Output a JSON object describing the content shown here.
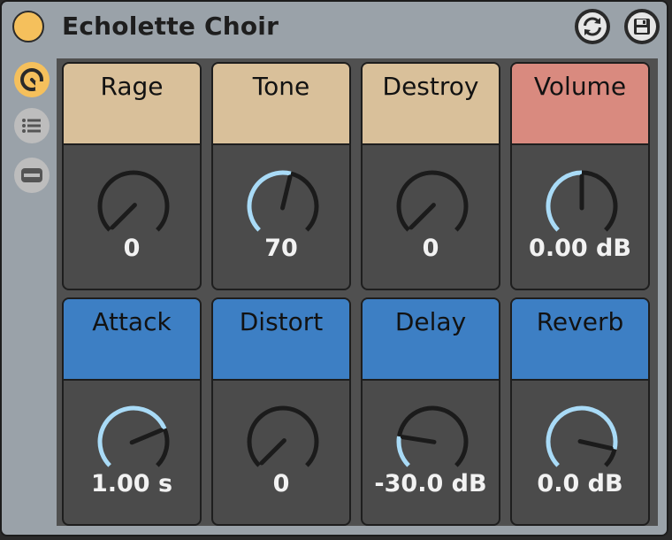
{
  "device": {
    "title": "Echolette Choir",
    "power_color": "#f5c05c",
    "icons": {
      "power": "power-toggle-icon",
      "hot_swap": "hot-swap-icon",
      "save": "save-preset-icon"
    }
  },
  "sidebar": {
    "items": [
      {
        "icon": "macro-knobs-icon",
        "active": true
      },
      {
        "icon": "list-icon",
        "active": false
      },
      {
        "icon": "collapse-icon",
        "active": false
      }
    ]
  },
  "macros": [
    {
      "label": "Rage",
      "value": "0",
      "level": 0.0,
      "header_color": "#d9c09a"
    },
    {
      "label": "Tone",
      "value": "70",
      "level": 0.55,
      "header_color": "#d9c09a"
    },
    {
      "label": "Destroy",
      "value": "0",
      "level": 0.0,
      "header_color": "#d9c09a"
    },
    {
      "label": "Volume",
      "value": "0.00 dB",
      "level": 0.5,
      "header_color": "#d98a7f"
    },
    {
      "label": "Attack",
      "value": "1.00 s",
      "level": 0.75,
      "header_color": "#3d7fc4"
    },
    {
      "label": "Distort",
      "value": "0",
      "level": 0.0,
      "header_color": "#3d7fc4"
    },
    {
      "label": "Delay",
      "value": "-30.0 dB",
      "level": 0.2,
      "header_color": "#3d7fc4"
    },
    {
      "label": "Reverb",
      "value": "0.0 dB",
      "level": 0.88,
      "header_color": "#3d7fc4"
    }
  ],
  "colors": {
    "arc_active": "#a9dbf7",
    "arc_track": "#1b1b1b",
    "pointer": "#1b1b1b"
  }
}
